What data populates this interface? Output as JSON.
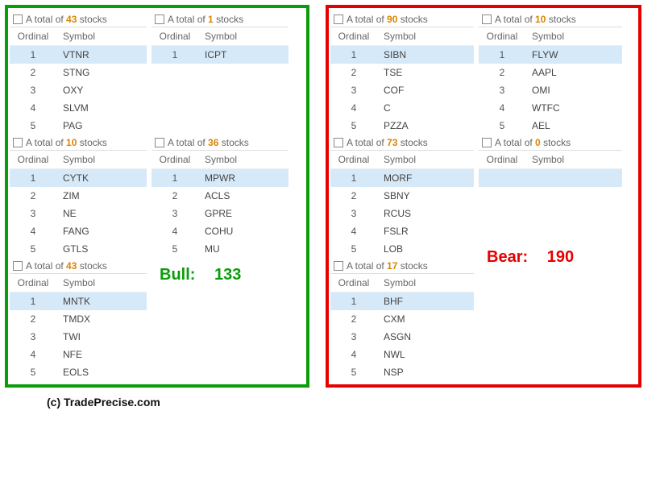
{
  "literals": {
    "head_prefix": "A total of ",
    "head_suffix": " stocks",
    "col_ordinal": "Ordinal",
    "col_symbol": "Symbol",
    "bull_label": "Bull:",
    "bear_label": "Bear:"
  },
  "bull": {
    "total": 133,
    "col1": [
      {
        "count": 43,
        "rows": [
          "VTNR",
          "STNG",
          "OXY",
          "SLVM",
          "PAG"
        ]
      },
      {
        "count": 10,
        "rows": [
          "CYTK",
          "ZIM",
          "NE",
          "FANG",
          "GTLS"
        ]
      },
      {
        "count": 43,
        "rows": [
          "MNTK",
          "TMDX",
          "TWI",
          "NFE",
          "EOLS"
        ]
      }
    ],
    "col2": [
      {
        "count": 1,
        "rows": [
          "ICPT"
        ],
        "pad": 4
      },
      {
        "count": 36,
        "rows": [
          "MPWR",
          "ACLS",
          "GPRE",
          "COHU",
          "MU"
        ]
      }
    ]
  },
  "bear": {
    "total": 190,
    "col1": [
      {
        "count": 90,
        "rows": [
          "SIBN",
          "TSE",
          "COF",
          "C",
          "PZZA"
        ]
      },
      {
        "count": 73,
        "rows": [
          "MORF",
          "SBNY",
          "RCUS",
          "FSLR",
          "LOB"
        ]
      },
      {
        "count": 17,
        "rows": [
          "BHF",
          "CXM",
          "ASGN",
          "NWL",
          "NSP"
        ]
      }
    ],
    "col2": [
      {
        "count": 10,
        "rows": [
          "FLYW",
          "AAPL",
          "OMI",
          "WTFC",
          "AEL"
        ]
      },
      {
        "count": 0,
        "rows": [],
        "pad": 4
      }
    ]
  },
  "footer": "(c) TradePrecise.com"
}
